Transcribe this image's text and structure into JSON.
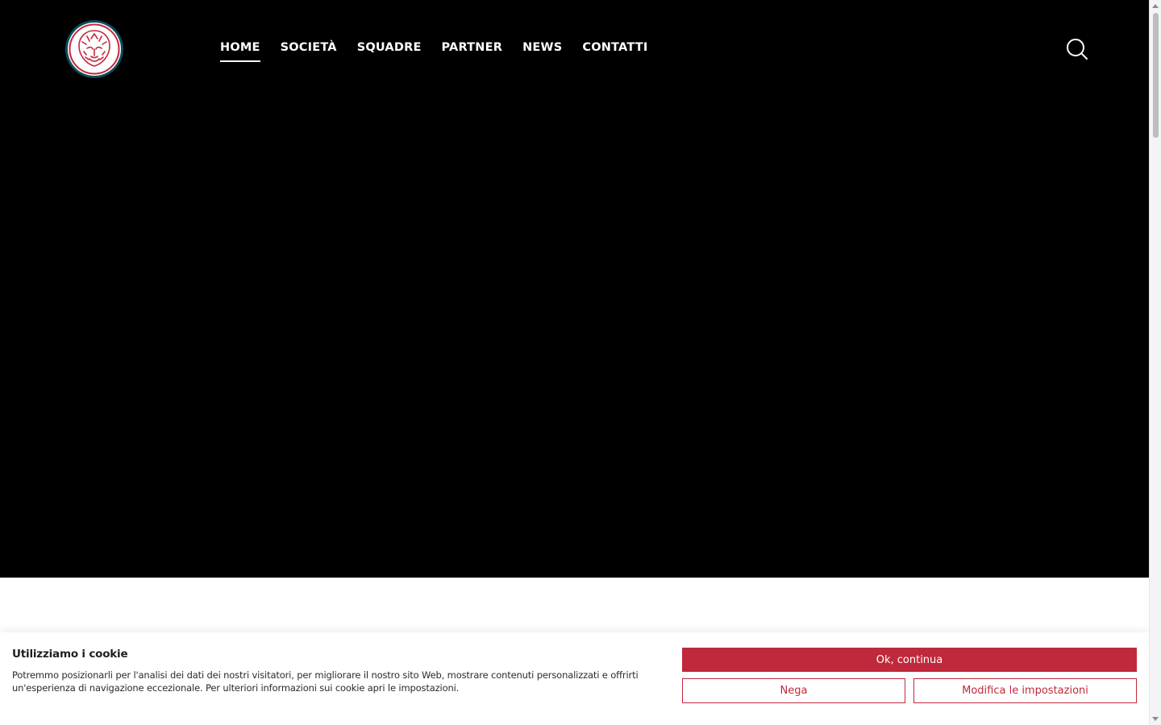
{
  "nav": {
    "items": [
      {
        "label": "HOME",
        "active": true
      },
      {
        "label": "SOCIETÀ",
        "active": false
      },
      {
        "label": "SQUADRE",
        "active": false
      },
      {
        "label": "PARTNER",
        "active": false
      },
      {
        "label": "NEWS",
        "active": false
      },
      {
        "label": "CONTATTI",
        "active": false
      }
    ]
  },
  "icons": {
    "logo": "lion-crest-logo",
    "search": "search-icon"
  },
  "colors": {
    "brand_red": "#c0293b",
    "logo_teal": "#0f4c5c",
    "hero_bg": "#000000"
  },
  "cookie": {
    "title": "Utilizziamo i cookie",
    "text": "Potremmo posizionarli per l'analisi dei dati dei nostri visitatori, per migliorare il nostro sito Web, mostrare contenuti personalizzati e offrirti un'esperienza di navigazione eccezionale. Per ulteriori informazioni sui cookie apri le impostazioni.",
    "accept_label": "Ok, continua",
    "deny_label": "Nega",
    "settings_label": "Modifica le impostazioni"
  }
}
